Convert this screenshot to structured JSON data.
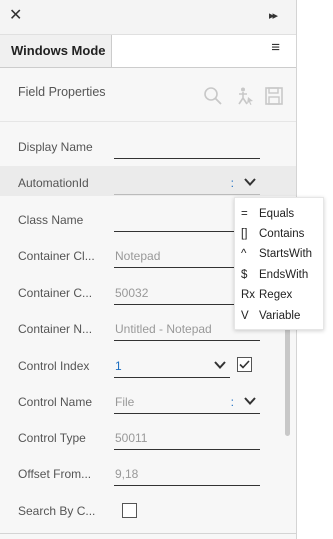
{
  "header": {
    "close_glyph": "✕",
    "collapse_glyph": "▸▸"
  },
  "tab": {
    "label": "Windows Mode",
    "menu_glyph": "≡"
  },
  "section": {
    "title": "Field Properties"
  },
  "fields": [
    {
      "label": "Display Name",
      "value": ""
    },
    {
      "label": "AutomationId",
      "value": "",
      "ops": ":"
    },
    {
      "label": "Class Name",
      "value": ""
    },
    {
      "label": "Container Cl...",
      "value": "Notepad"
    },
    {
      "label": "Container C...",
      "value": "50032"
    },
    {
      "label": "Container N...",
      "value": "Untitled - Notepad"
    },
    {
      "label": "Control Index",
      "value": "1"
    },
    {
      "label": "Control Name",
      "value": "File",
      "ops": ":"
    },
    {
      "label": "Control Type",
      "value": "50011"
    },
    {
      "label": "Offset From...",
      "value": "9,18"
    },
    {
      "label": "Search By C...",
      "value": ""
    }
  ],
  "popup": {
    "items": [
      {
        "symbol": "=",
        "label": "Equals"
      },
      {
        "symbol": "[]",
        "label": "Contains"
      },
      {
        "symbol": "^",
        "label": "StartsWith"
      },
      {
        "symbol": "$",
        "label": "EndsWith"
      },
      {
        "symbol": "Rx",
        "label": "Regex"
      },
      {
        "symbol": "V",
        "label": "Variable"
      }
    ]
  },
  "colors": {
    "accent": "#1c6ec2",
    "placeholder": "#999999",
    "panel_bg": "#f7f7f7"
  }
}
